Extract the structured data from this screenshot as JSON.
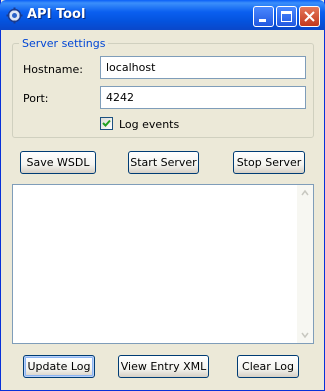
{
  "window": {
    "title": "API Tool",
    "app_icon": "app-gears-icon",
    "controls": [
      "minimize-icon",
      "maximize-icon",
      "close-icon"
    ]
  },
  "server_settings": {
    "legend": "Server settings",
    "hostname_label": "Hostname:",
    "hostname_value": "localhost",
    "port_label": "Port:",
    "port_value": "4242",
    "log_events_label": "Log events",
    "log_events_checked": true
  },
  "actions": {
    "save_wsdl": "Save WSDL",
    "start_server": "Start Server",
    "stop_server": "Stop Server"
  },
  "log": {
    "content": ""
  },
  "footer": {
    "update_log": "Update Log",
    "view_entry_xml": "View Entry XML",
    "clear_log": "Clear Log"
  },
  "colors": {
    "titlebar": "#0a5ff0",
    "window_bg": "#ece9d8",
    "group_legend": "#0046d5",
    "checkmark": "#21a121"
  }
}
